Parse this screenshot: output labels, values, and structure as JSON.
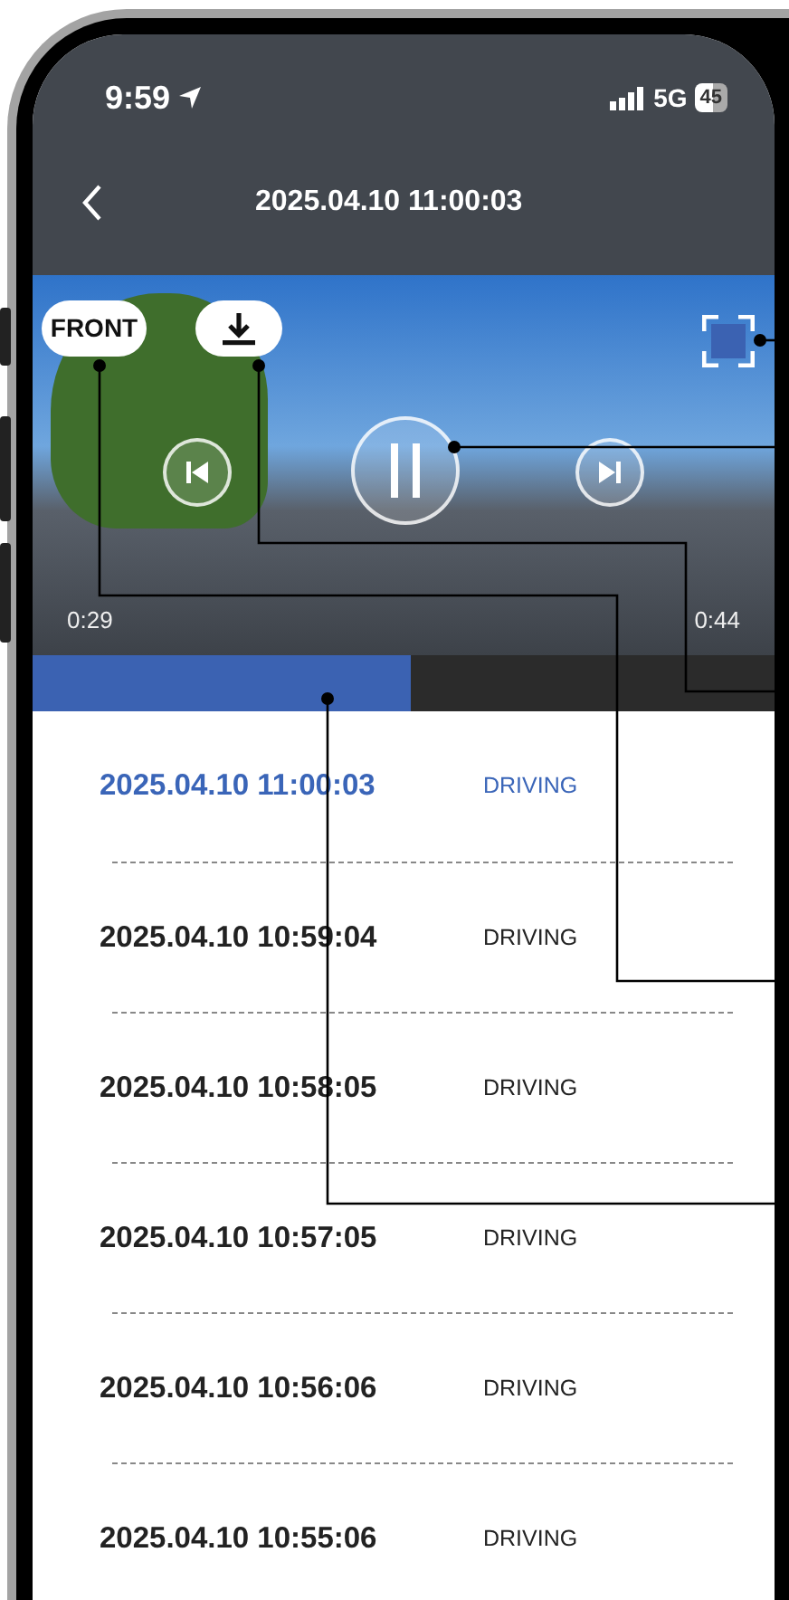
{
  "status_bar": {
    "time": "9:59",
    "network": "5G",
    "battery": "45"
  },
  "header": {
    "title": "2025.04.10 11:00:03"
  },
  "player": {
    "camera_label": "FRONT",
    "elapsed": "0:29",
    "remaining": "0:44",
    "playing": true
  },
  "progress": {
    "level": 0.51
  },
  "recordings": [
    {
      "timestamp": "2025.04.10 11:00:03",
      "type": "DRIVING",
      "selected": true
    },
    {
      "timestamp": "2025.04.10 10:59:04",
      "type": "DRIVING",
      "selected": false
    },
    {
      "timestamp": "2025.04.10 10:58:05",
      "type": "DRIVING",
      "selected": false
    },
    {
      "timestamp": "2025.04.10 10:57:05",
      "type": "DRIVING",
      "selected": false
    },
    {
      "timestamp": "2025.04.10 10:56:06",
      "type": "DRIVING",
      "selected": false
    },
    {
      "timestamp": "2025.04.10 10:55:06",
      "type": "DRIVING",
      "selected": false
    }
  ]
}
